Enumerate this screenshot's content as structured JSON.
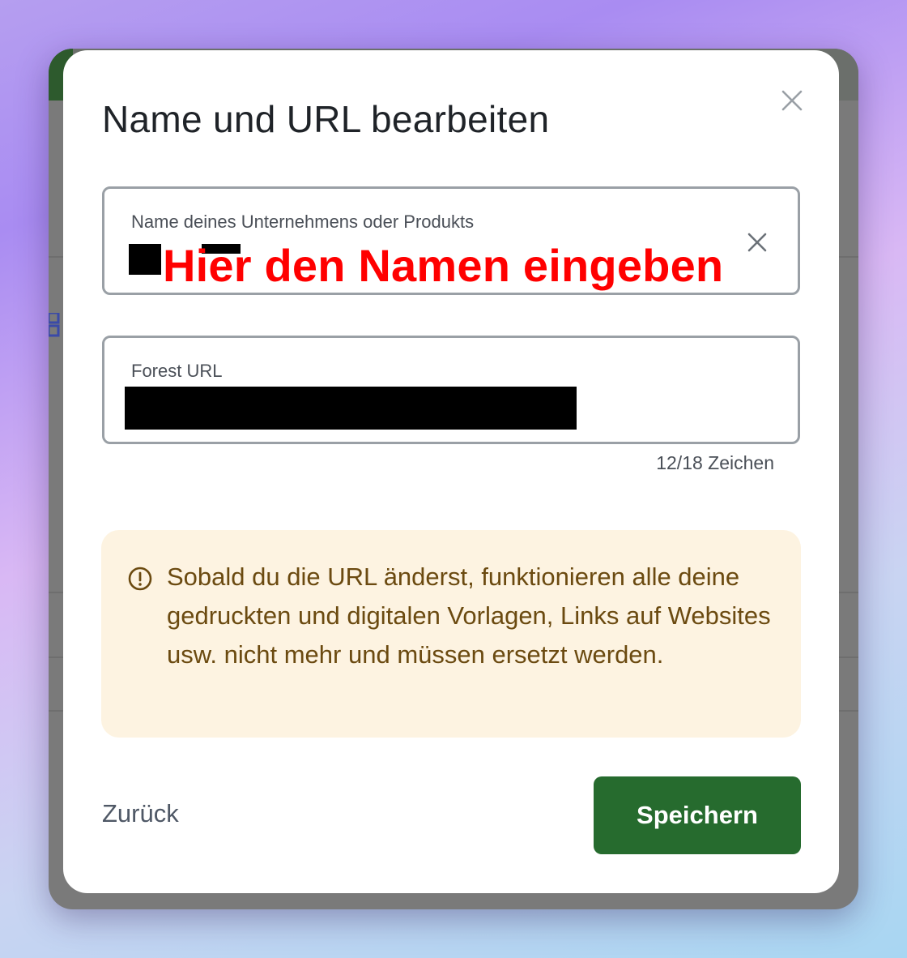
{
  "dialog": {
    "title": "Name und URL bearbeiten",
    "close_icon": "close-icon"
  },
  "name_field": {
    "label": "Name deines Unternehmens oder Produkts",
    "value": "",
    "clear_icon": "close-icon",
    "annotation": "Hier den Namen eingeben"
  },
  "url_field": {
    "label": "Forest URL",
    "value": ""
  },
  "char_counter": "12/18 Zeichen",
  "warning": {
    "icon": "info-circle-icon",
    "text": "Sobald du die URL änderst, funktionieren alle deine gedruckten und digitalen Vorlagen, Links auf Websites usw. nicht mehr und müssen ersetzt werden."
  },
  "actions": {
    "back_label": "Zurück",
    "save_label": "Speichern"
  },
  "colors": {
    "primary_button": "#266b2e",
    "warning_background": "#fdf3e1",
    "warning_text": "#6b4a10",
    "annotation_red": "#ff0000"
  }
}
